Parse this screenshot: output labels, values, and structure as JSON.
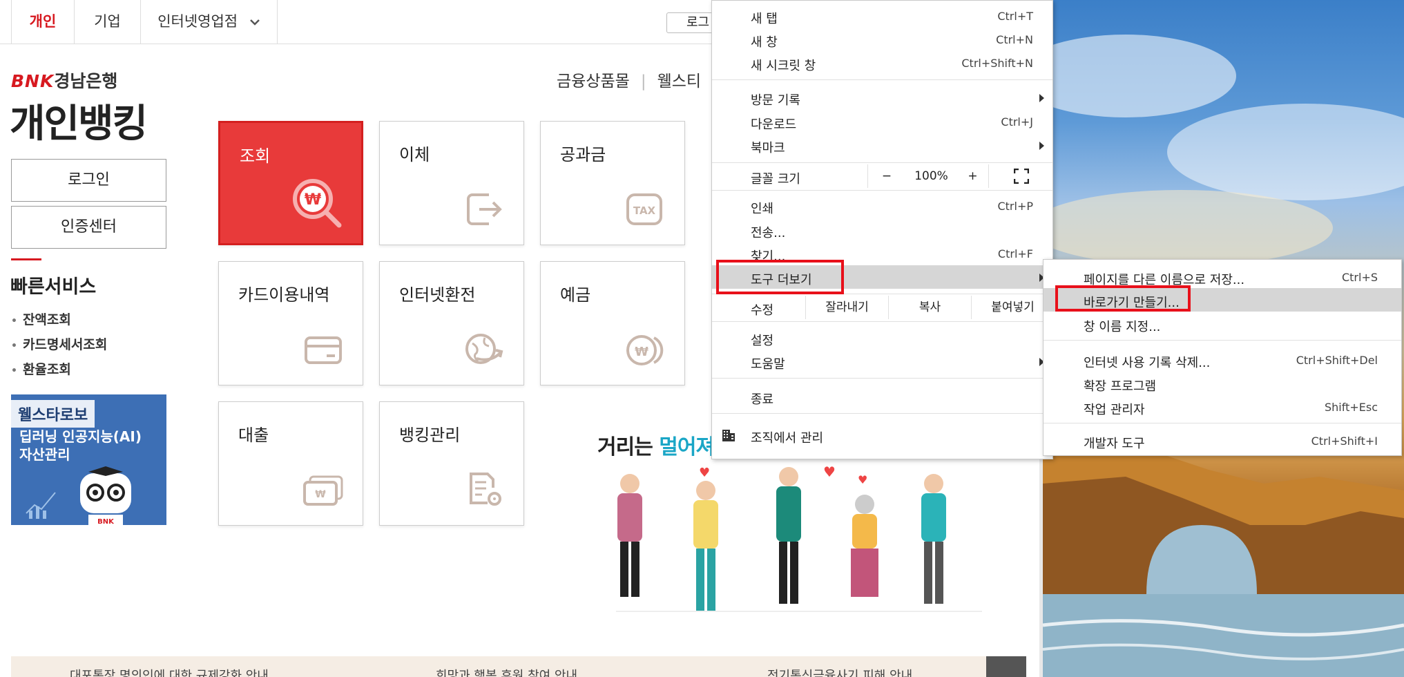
{
  "top_nav": {
    "tabs": [
      {
        "label": "개인",
        "active": true
      },
      {
        "label": "기업",
        "active": false
      },
      {
        "label": "인터넷영업점",
        "active": false
      }
    ],
    "login_mini": "로그"
  },
  "logo": {
    "brand": "BNK",
    "bank": "경남은행"
  },
  "page_title": "개인뱅킹",
  "gnb": {
    "items": [
      "금융상품몰",
      "웰스티"
    ]
  },
  "side": {
    "login_button": "로그인",
    "cert_button": "인증센터",
    "quick_title": "빠른서비스",
    "quick_items": [
      "잔액조회",
      "카드명세서조회",
      "환율조회"
    ]
  },
  "ai_banner": {
    "tag": "웰스타로보",
    "line1": "딥러닝 인공지능(AI)",
    "line2": "자산관리",
    "robot_badge": "BNK"
  },
  "menu_tiles": [
    {
      "label": "조회",
      "icon": "search-won-icon"
    },
    {
      "label": "이체",
      "icon": "transfer-exit-icon"
    },
    {
      "label": "공과금",
      "icon": "tax-icon"
    },
    {
      "label": "카드이용내역",
      "icon": "card-icon"
    },
    {
      "label": "인터넷환전",
      "icon": "globe-exchange-icon"
    },
    {
      "label": "예금",
      "icon": "deposit-coin-icon"
    },
    {
      "label": "대출",
      "icon": "loan-cash-icon"
    },
    {
      "label": "뱅킹관리",
      "icon": "document-gear-icon"
    }
  ],
  "promo": {
    "headline_prefix": "거리는 ",
    "headline_accent": "멀어져"
  },
  "notices": [
    "대포통장 명의인에 대한 규제강화 안내",
    "희망과 행복 후원 참여 안내",
    "전기통신금융사기 피해 안내"
  ],
  "browser_menu": {
    "new_tab": {
      "label": "새 탭",
      "shortcut": "Ctrl+T"
    },
    "new_window": {
      "label": "새 창",
      "shortcut": "Ctrl+N"
    },
    "incognito": {
      "label": "새 시크릿 창",
      "shortcut": "Ctrl+Shift+N"
    },
    "history": {
      "label": "방문 기록"
    },
    "downloads": {
      "label": "다운로드",
      "shortcut": "Ctrl+J"
    },
    "bookmarks": {
      "label": "북마크"
    },
    "zoom": {
      "label": "글꼴 크기",
      "minus": "−",
      "value": "100%",
      "plus": "+"
    },
    "print": {
      "label": "인쇄",
      "shortcut": "Ctrl+P"
    },
    "cast": {
      "label": "전송..."
    },
    "find": {
      "label": "찾기...",
      "shortcut": "Ctrl+F"
    },
    "more_tools": {
      "label": "도구 더보기"
    },
    "edit": {
      "label": "수정",
      "cut": "잘라내기",
      "copy": "복사",
      "paste": "붙여넣기"
    },
    "settings": {
      "label": "설정"
    },
    "help": {
      "label": "도움말"
    },
    "exit": {
      "label": "종료"
    },
    "managed": {
      "label": "조직에서 관리"
    }
  },
  "sub_menu": {
    "save_as": {
      "label": "페이지를 다른 이름으로 저장...",
      "shortcut": "Ctrl+S"
    },
    "create_shortcut": {
      "label": "바로가기 만들기..."
    },
    "name_window": {
      "label": "창 이름 지정..."
    },
    "clear_data": {
      "label": "인터넷 사용 기록 삭제...",
      "shortcut": "Ctrl+Shift+Del"
    },
    "extensions": {
      "label": "확장 프로그램"
    },
    "task_manager": {
      "label": "작업 관리자",
      "shortcut": "Shift+Esc"
    },
    "dev_tools": {
      "label": "개발자 도구",
      "shortcut": "Ctrl+Shift+I"
    }
  },
  "colors": {
    "brand_red": "#d71920",
    "highlight": "#e8101a",
    "menu_hover": "#d6d6d6"
  }
}
